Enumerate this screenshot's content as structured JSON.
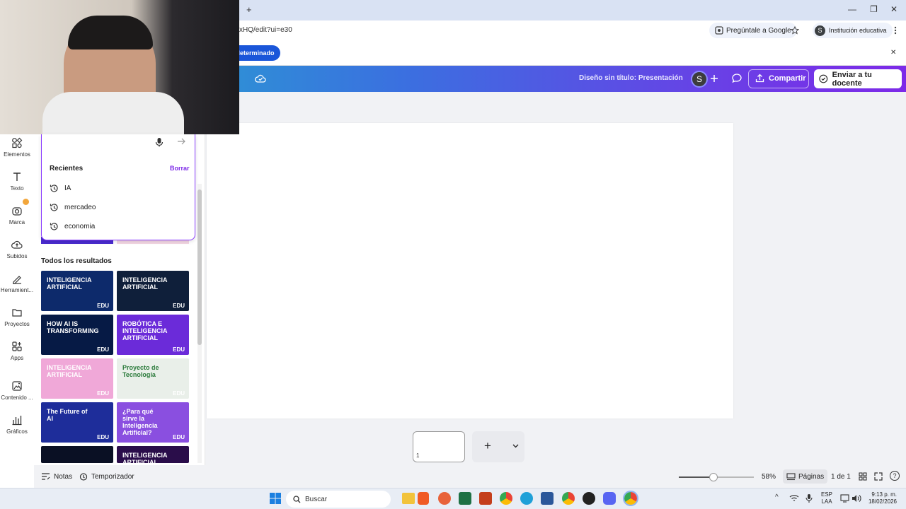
{
  "browser": {
    "new_tab_glyph": "+",
    "url": "xHQ/edit?ui=e30",
    "ask_google": "Pregúntale a Google",
    "profile_initial": "S",
    "profile_label": "Institución educativa",
    "minimize": "—",
    "restore": "❐",
    "close": "✕"
  },
  "infobar": {
    "button_label": "leterminado",
    "close": "✕"
  },
  "canva_header": {
    "doc_title": "Diseño sin título: Presentación",
    "avatar_initial": "S",
    "share_label": "Compartir",
    "send_teacher_label": "Enviar a tu docente"
  },
  "sidebar": {
    "items": [
      {
        "label": "Elementos",
        "icon": "elements-icon"
      },
      {
        "label": "Texto",
        "icon": "text-icon"
      },
      {
        "label": "Marca",
        "icon": "brand-icon"
      },
      {
        "label": "Subidos",
        "icon": "upload-cloud-icon"
      },
      {
        "label": "Herramient...",
        "icon": "tools-icon"
      },
      {
        "label": "Proyectos",
        "icon": "folder-icon"
      },
      {
        "label": "Apps",
        "icon": "apps-icon"
      },
      {
        "label": "Contenido ...",
        "icon": "magic-media-icon"
      },
      {
        "label": "Gráficos",
        "icon": "charts-icon"
      }
    ]
  },
  "panel": {
    "recent_heading": "Recientes",
    "clear_label": "Borrar",
    "recent_items": [
      "IA",
      "mercadeo",
      "economia"
    ],
    "all_results_heading": "Todos los resultados",
    "badge": "EDU",
    "thumbs": [
      {
        "title": "INTELIGENCIA ARTIFICIAL",
        "bg": "#0d2a6b"
      },
      {
        "title": "INTELIGENCIA ARTIFICIAL",
        "bg": "#0f1f3a"
      },
      {
        "title": "HOW AI IS TRANSFORMING",
        "bg": "#061a45"
      },
      {
        "title": "ROBÓTICA E INTELIGENCIA ARTIFICIAL",
        "bg": "#6b2bd9"
      },
      {
        "title": "INTELIGENCIA ARTIFICIAL",
        "bg": "#f0a8d8"
      },
      {
        "title": "Proyecto de Tecnología",
        "bg": "#e9efe9"
      },
      {
        "title": "The Future of AI",
        "bg": "#1e2d9a"
      },
      {
        "title": "¿Para qué sirve la Inteligencia Artificial?",
        "bg": "#8a4fe0"
      },
      {
        "title": "",
        "bg": "#0a1024"
      },
      {
        "title": "INTELIGENCIA ARTIFICIAL",
        "bg": "#2a0d4a"
      }
    ]
  },
  "pages": {
    "page_number": "1",
    "add": "+",
    "chevron": "⌄"
  },
  "footer": {
    "notes_label": "Notas",
    "timer_label": "Temporizador",
    "zoom_label": "58%",
    "zoom_level": 0.46,
    "pages_label": "Páginas",
    "page_count": "1 de 1",
    "help": "?"
  },
  "taskbar": {
    "search_placeholder": "Buscar",
    "lang_top": "ESP",
    "lang_bottom": "LAA",
    "time": "9:13 p. m.",
    "date": "18/02/2026",
    "chevron_up": "^"
  },
  "colors": {
    "canva_purple": "#7d2ae8",
    "link_purple": "#7d2ae8",
    "browser_blue": "#1a56d9"
  }
}
